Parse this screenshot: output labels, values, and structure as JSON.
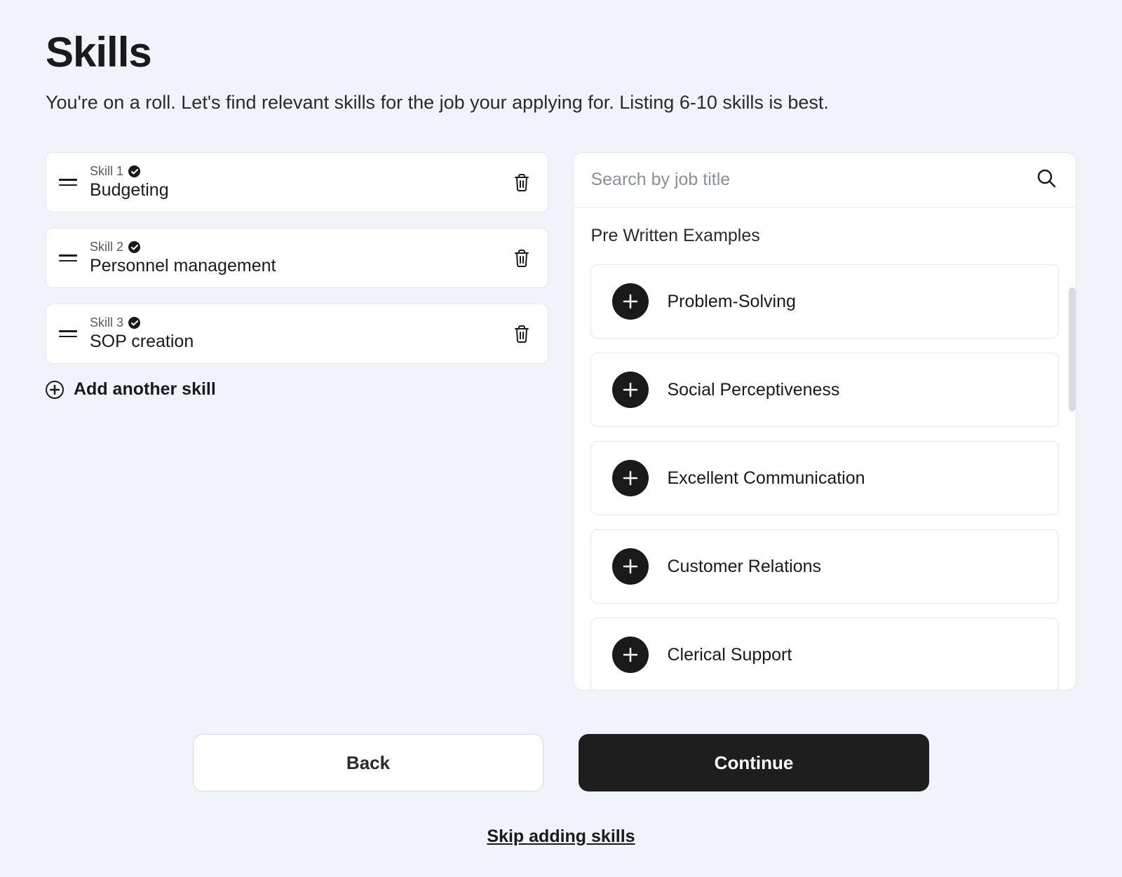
{
  "header": {
    "title": "Skills",
    "subtitle": "You're on a roll. Let's find relevant skills for the job your applying for. Listing 6-10 skills is best."
  },
  "skills": [
    {
      "label": "Skill 1",
      "value": "Budgeting"
    },
    {
      "label": "Skill 2",
      "value": "Personnel management"
    },
    {
      "label": "Skill 3",
      "value": "SOP creation"
    }
  ],
  "add_skill_label": "Add another skill",
  "search": {
    "placeholder": "Search by job title"
  },
  "panel": {
    "heading": "Pre Written Examples",
    "examples": [
      "Problem-Solving",
      "Social Perceptiveness",
      "Excellent Communication",
      "Customer Relations",
      "Clerical Support"
    ]
  },
  "buttons": {
    "back": "Back",
    "continue": "Continue",
    "skip": "Skip adding skills"
  }
}
